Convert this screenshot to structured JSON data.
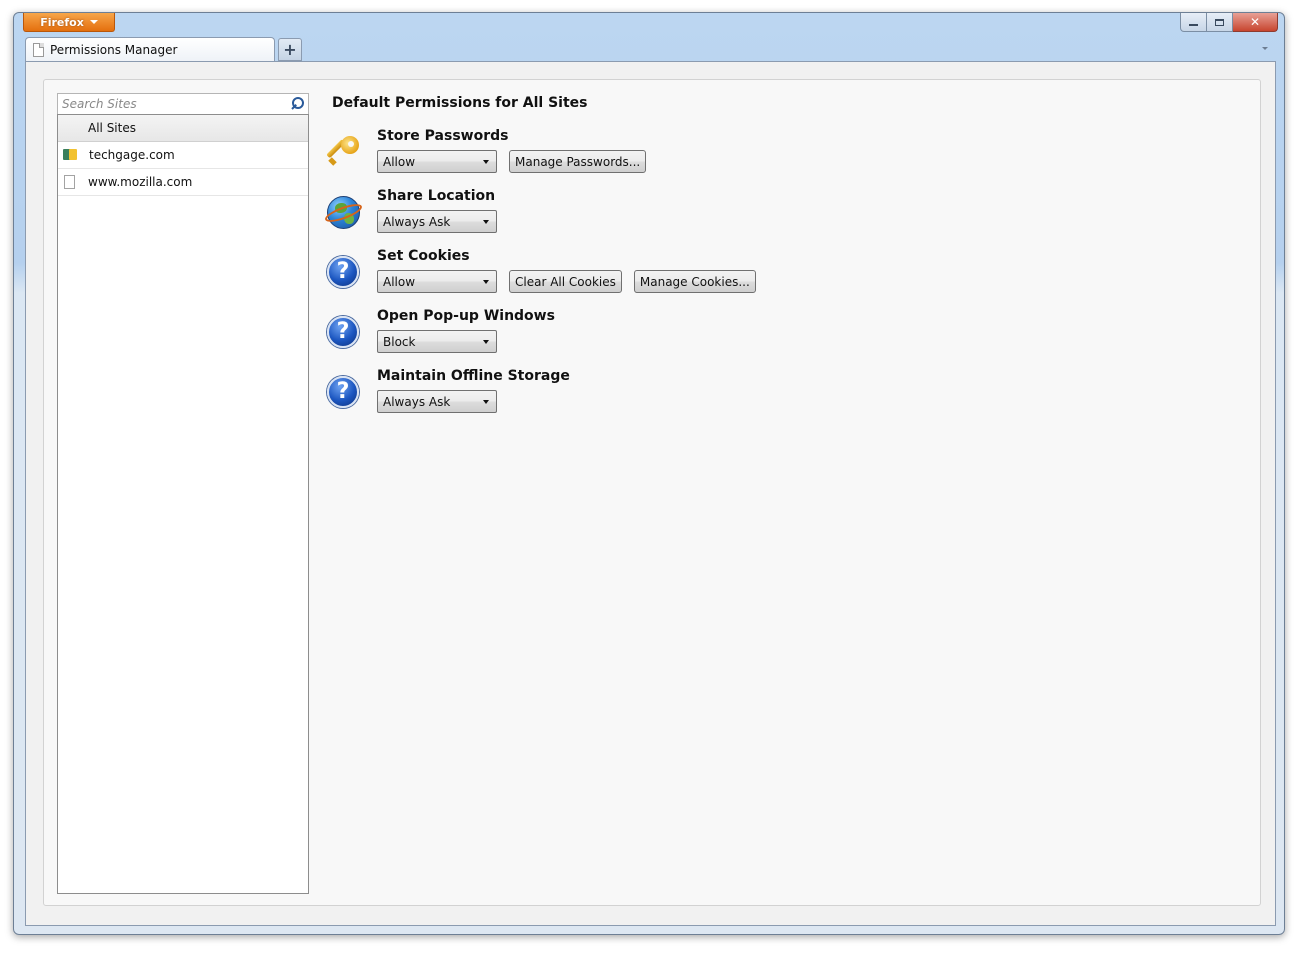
{
  "window": {
    "firefox_button": "Firefox",
    "tab_title": "Permissions Manager",
    "new_tab": "+"
  },
  "sidebar": {
    "search_placeholder": "Search Sites",
    "sites": [
      {
        "label": "All Sites",
        "icon": "none",
        "selected": true
      },
      {
        "label": "techgage.com",
        "icon": "techgage-favicon-icon",
        "selected": false
      },
      {
        "label": "www.mozilla.com",
        "icon": "page-icon",
        "selected": false
      }
    ]
  },
  "main": {
    "title": "Default Permissions for All Sites",
    "permissions": [
      {
        "label": "Store Passwords",
        "icon": "key-icon",
        "value": "Allow",
        "buttons": [
          "Manage Passwords..."
        ]
      },
      {
        "label": "Share Location",
        "icon": "globe-icon",
        "value": "Always Ask",
        "buttons": []
      },
      {
        "label": "Set Cookies",
        "icon": "help-icon",
        "value": "Allow",
        "buttons": [
          "Clear All Cookies",
          "Manage Cookies..."
        ]
      },
      {
        "label": "Open Pop-up Windows",
        "icon": "help-icon",
        "value": "Block",
        "buttons": []
      },
      {
        "label": "Maintain Offline Storage",
        "icon": "help-icon",
        "value": "Always Ask",
        "buttons": []
      }
    ]
  }
}
